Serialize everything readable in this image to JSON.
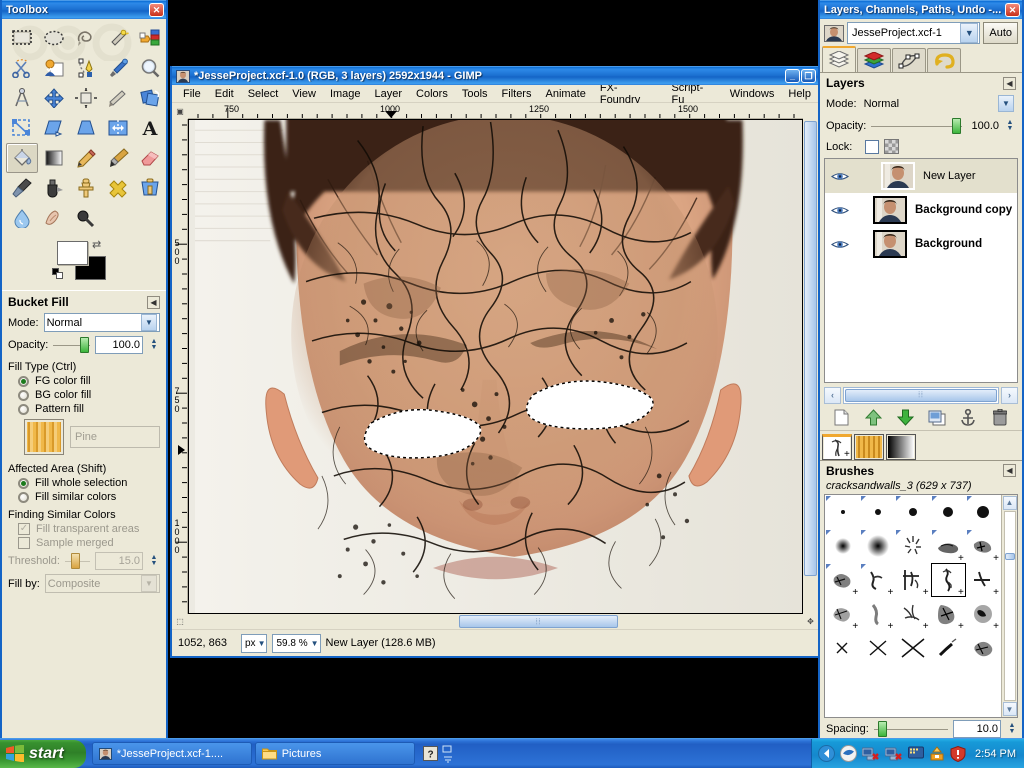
{
  "toolbox": {
    "title": "Toolbox",
    "close_label": "✕",
    "tools": [
      {
        "name": "rect-select-tool",
        "label": "Rectangle Select"
      },
      {
        "name": "ellipse-select-tool",
        "label": "Ellipse Select"
      },
      {
        "name": "free-select-tool",
        "label": "Free Select (Lasso)"
      },
      {
        "name": "fuzzy-select-tool",
        "label": "Fuzzy Select (Magic Wand)"
      },
      {
        "name": "select-by-color-tool",
        "label": "Select by Color"
      },
      {
        "name": "scissors-select-tool",
        "label": "Intelligent Scissors"
      },
      {
        "name": "foreground-select-tool",
        "label": "Foreground Select"
      },
      {
        "name": "paths-tool",
        "label": "Paths"
      },
      {
        "name": "color-picker-tool",
        "label": "Color Picker"
      },
      {
        "name": "zoom-tool",
        "label": "Zoom"
      },
      {
        "name": "measure-tool",
        "label": "Measure"
      },
      {
        "name": "move-tool",
        "label": "Move"
      },
      {
        "name": "align-tool",
        "label": "Alignment"
      },
      {
        "name": "crop-tool",
        "label": "Crop"
      },
      {
        "name": "rotate-tool",
        "label": "Rotate"
      },
      {
        "name": "scale-tool",
        "label": "Scale"
      },
      {
        "name": "shear-tool",
        "label": "Shear"
      },
      {
        "name": "perspective-tool",
        "label": "Perspective"
      },
      {
        "name": "flip-tool",
        "label": "Flip"
      },
      {
        "name": "text-tool",
        "label": "Text"
      },
      {
        "name": "bucket-fill-tool",
        "label": "Bucket Fill"
      },
      {
        "name": "gradient-tool",
        "label": "Blend (Gradient)"
      },
      {
        "name": "pencil-tool",
        "label": "Pencil"
      },
      {
        "name": "paintbrush-tool",
        "label": "Paintbrush"
      },
      {
        "name": "eraser-tool",
        "label": "Eraser"
      },
      {
        "name": "airbrush-tool",
        "label": "Airbrush"
      },
      {
        "name": "ink-tool",
        "label": "Ink"
      },
      {
        "name": "clone-tool",
        "label": "Clone"
      },
      {
        "name": "heal-tool",
        "label": "Heal"
      },
      {
        "name": "perspective-clone-tool",
        "label": "Perspective Clone"
      },
      {
        "name": "blur-sharpen-tool",
        "label": "Blur / Sharpen"
      },
      {
        "name": "smudge-tool",
        "label": "Smudge"
      },
      {
        "name": "dodge-burn-tool",
        "label": "Dodge / Burn"
      }
    ],
    "active_tool_index": 20,
    "colors": {
      "foreground": "#ffffff",
      "background": "#000000"
    }
  },
  "tool_options": {
    "title": "Bucket Fill",
    "mode_label": "Mode:",
    "mode_value": "Normal",
    "opacity_label": "Opacity:",
    "opacity_value": "100.0",
    "fill_type_label": "Fill Type  (Ctrl)",
    "fill_type_options": [
      "FG color fill",
      "BG color fill",
      "Pattern fill"
    ],
    "fill_type_selected": 0,
    "pattern_name": "Pine",
    "affected_area_label": "Affected Area  (Shift)",
    "affected_area_options": [
      "Fill whole selection",
      "Fill similar colors"
    ],
    "affected_area_selected": 0,
    "finding_label": "Finding Similar Colors",
    "fill_transparent_label": "Fill transparent areas",
    "sample_merged_label": "Sample merged",
    "threshold_label": "Threshold:",
    "threshold_value": "15.0",
    "fill_by_label": "Fill by:",
    "fill_by_value": "Composite"
  },
  "image_window": {
    "title": "*JesseProject.xcf-1.0 (RGB, 3 layers) 2592x1944 - GIMP",
    "minimize_label": "_",
    "restore_label": "❐",
    "menus": [
      "File",
      "Edit",
      "Select",
      "View",
      "Image",
      "Layer",
      "Colors",
      "Tools",
      "Filters",
      "Animate",
      "FX-Foundry",
      "Script-Fu",
      "Windows",
      "Help"
    ],
    "ruler_h_labels": [
      "750",
      "1000",
      "1250",
      "1500"
    ],
    "ruler_v_labels": [
      "500",
      "750",
      "1000"
    ],
    "status": {
      "pointer_position": "1052, 863",
      "unit": "px",
      "zoom": "59.8 %",
      "message": "New Layer (128.6 MB)"
    }
  },
  "dock": {
    "title": "Layers, Channels, Paths, Undo -...",
    "close_label": "✕",
    "image_name": "JesseProject.xcf-1",
    "auto_label": "Auto",
    "tabs": [
      {
        "name": "tab-layers",
        "label": "Layers"
      },
      {
        "name": "tab-channels",
        "label": "Channels"
      },
      {
        "name": "tab-paths",
        "label": "Paths"
      },
      {
        "name": "tab-undo",
        "label": "Undo History"
      }
    ],
    "active_tab": 0,
    "layers_panel": {
      "title": "Layers",
      "mode_label": "Mode:",
      "mode_value": "Normal",
      "opacity_label": "Opacity:",
      "opacity_value": "100.0",
      "lock_label": "Lock:",
      "layers": [
        {
          "name": "New Layer",
          "visible": true,
          "selected": true
        },
        {
          "name": "Background copy",
          "visible": true,
          "selected": false
        },
        {
          "name": "Background",
          "visible": true,
          "selected": false
        }
      ],
      "buttons": [
        {
          "name": "new-layer-button",
          "label": "New Layer"
        },
        {
          "name": "raise-layer-button",
          "label": "Raise Layer"
        },
        {
          "name": "lower-layer-button",
          "label": "Lower Layer"
        },
        {
          "name": "duplicate-layer-button",
          "label": "Duplicate Layer"
        },
        {
          "name": "anchor-layer-button",
          "label": "Anchor Layer"
        },
        {
          "name": "delete-layer-button",
          "label": "Delete Layer"
        }
      ]
    },
    "brushes_panel": {
      "tabs": [
        {
          "name": "tab-brushes",
          "label": "Brushes"
        },
        {
          "name": "tab-patterns",
          "label": "Patterns"
        },
        {
          "name": "tab-gradients",
          "label": "Gradients"
        }
      ],
      "active_tab": 0,
      "title": "Brushes",
      "selected_brush": "cracksandwalls_3 (629 x 737)",
      "selected_index": 13,
      "spacing_label": "Spacing:",
      "spacing_value": "10.0"
    }
  },
  "taskbar": {
    "start_label": "start",
    "tasks": [
      {
        "name": "taskbar-item-gimp",
        "label": "*JesseProject.xcf-1...."
      },
      {
        "name": "taskbar-item-pictures",
        "label": "Pictures"
      }
    ],
    "clock": "2:54 PM"
  },
  "colors": {
    "xp_blue": "#1464c6",
    "panel_bg": "#ece9d8",
    "accent_orange": "#f0a830"
  }
}
